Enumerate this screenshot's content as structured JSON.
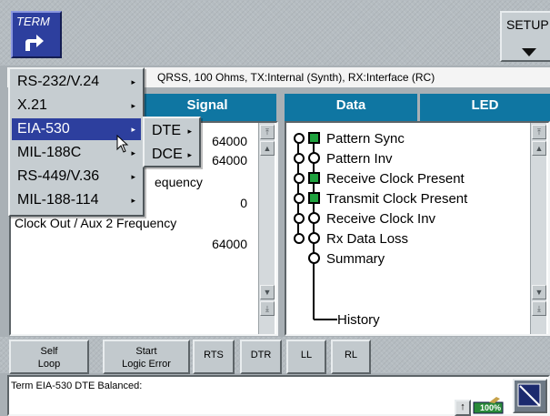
{
  "top_bar": {
    "term_label": "TERM",
    "setup_label": "SETUP"
  },
  "info_line": "QRSS, 100 Ohms, TX:Internal (Synth), RX:Interface (RC)",
  "left_header": "Signal",
  "right_headers": {
    "data": "Data",
    "led": "LED"
  },
  "signal_rows": [
    {
      "label": "",
      "value": "64000"
    },
    {
      "label": "",
      "value": "64000"
    },
    {
      "label": "equency",
      "value": ""
    },
    {
      "label": "",
      "value": "0"
    },
    {
      "label": "Clock Out / Aux 2 Frequency",
      "value": ""
    },
    {
      "label": "",
      "value": "64000"
    }
  ],
  "leds": [
    {
      "label": "Pattern Sync",
      "state": "on",
      "shape": "square"
    },
    {
      "label": "Pattern Inv",
      "state": "off",
      "shape": "round"
    },
    {
      "label": "Receive Clock Present",
      "state": "on",
      "shape": "square"
    },
    {
      "label": "Transmit Clock Present",
      "state": "on",
      "shape": "square"
    },
    {
      "label": "Receive Clock Inv",
      "state": "off",
      "shape": "round"
    },
    {
      "label": "Rx Data Loss",
      "state": "off",
      "shape": "round"
    },
    {
      "label": "Summary",
      "state": "off",
      "shape": "round"
    }
  ],
  "history_label": "History",
  "toolbar": {
    "self_loop_1": "Self",
    "self_loop_2": "Loop",
    "logic_error_1": "Start",
    "logic_error_2": "Logic Error",
    "rts": "RTS",
    "dtr": "DTR",
    "ll": "LL",
    "rl": "RL"
  },
  "status_text": "Term EIA-530 DTE Balanced:",
  "battery_label": "100%",
  "interface_menu": [
    "RS-232/V.24",
    "X.21",
    "EIA-530",
    "MIL-188C",
    "RS-449/V.36",
    "MIL-188-114"
  ],
  "interface_menu_selected": "EIA-530",
  "submenu": [
    "DTE",
    "DCE"
  ],
  "colors": {
    "header_blue": "#0f76a2",
    "selection_blue": "#2d3f9e",
    "led_green": "#1fa23e"
  }
}
